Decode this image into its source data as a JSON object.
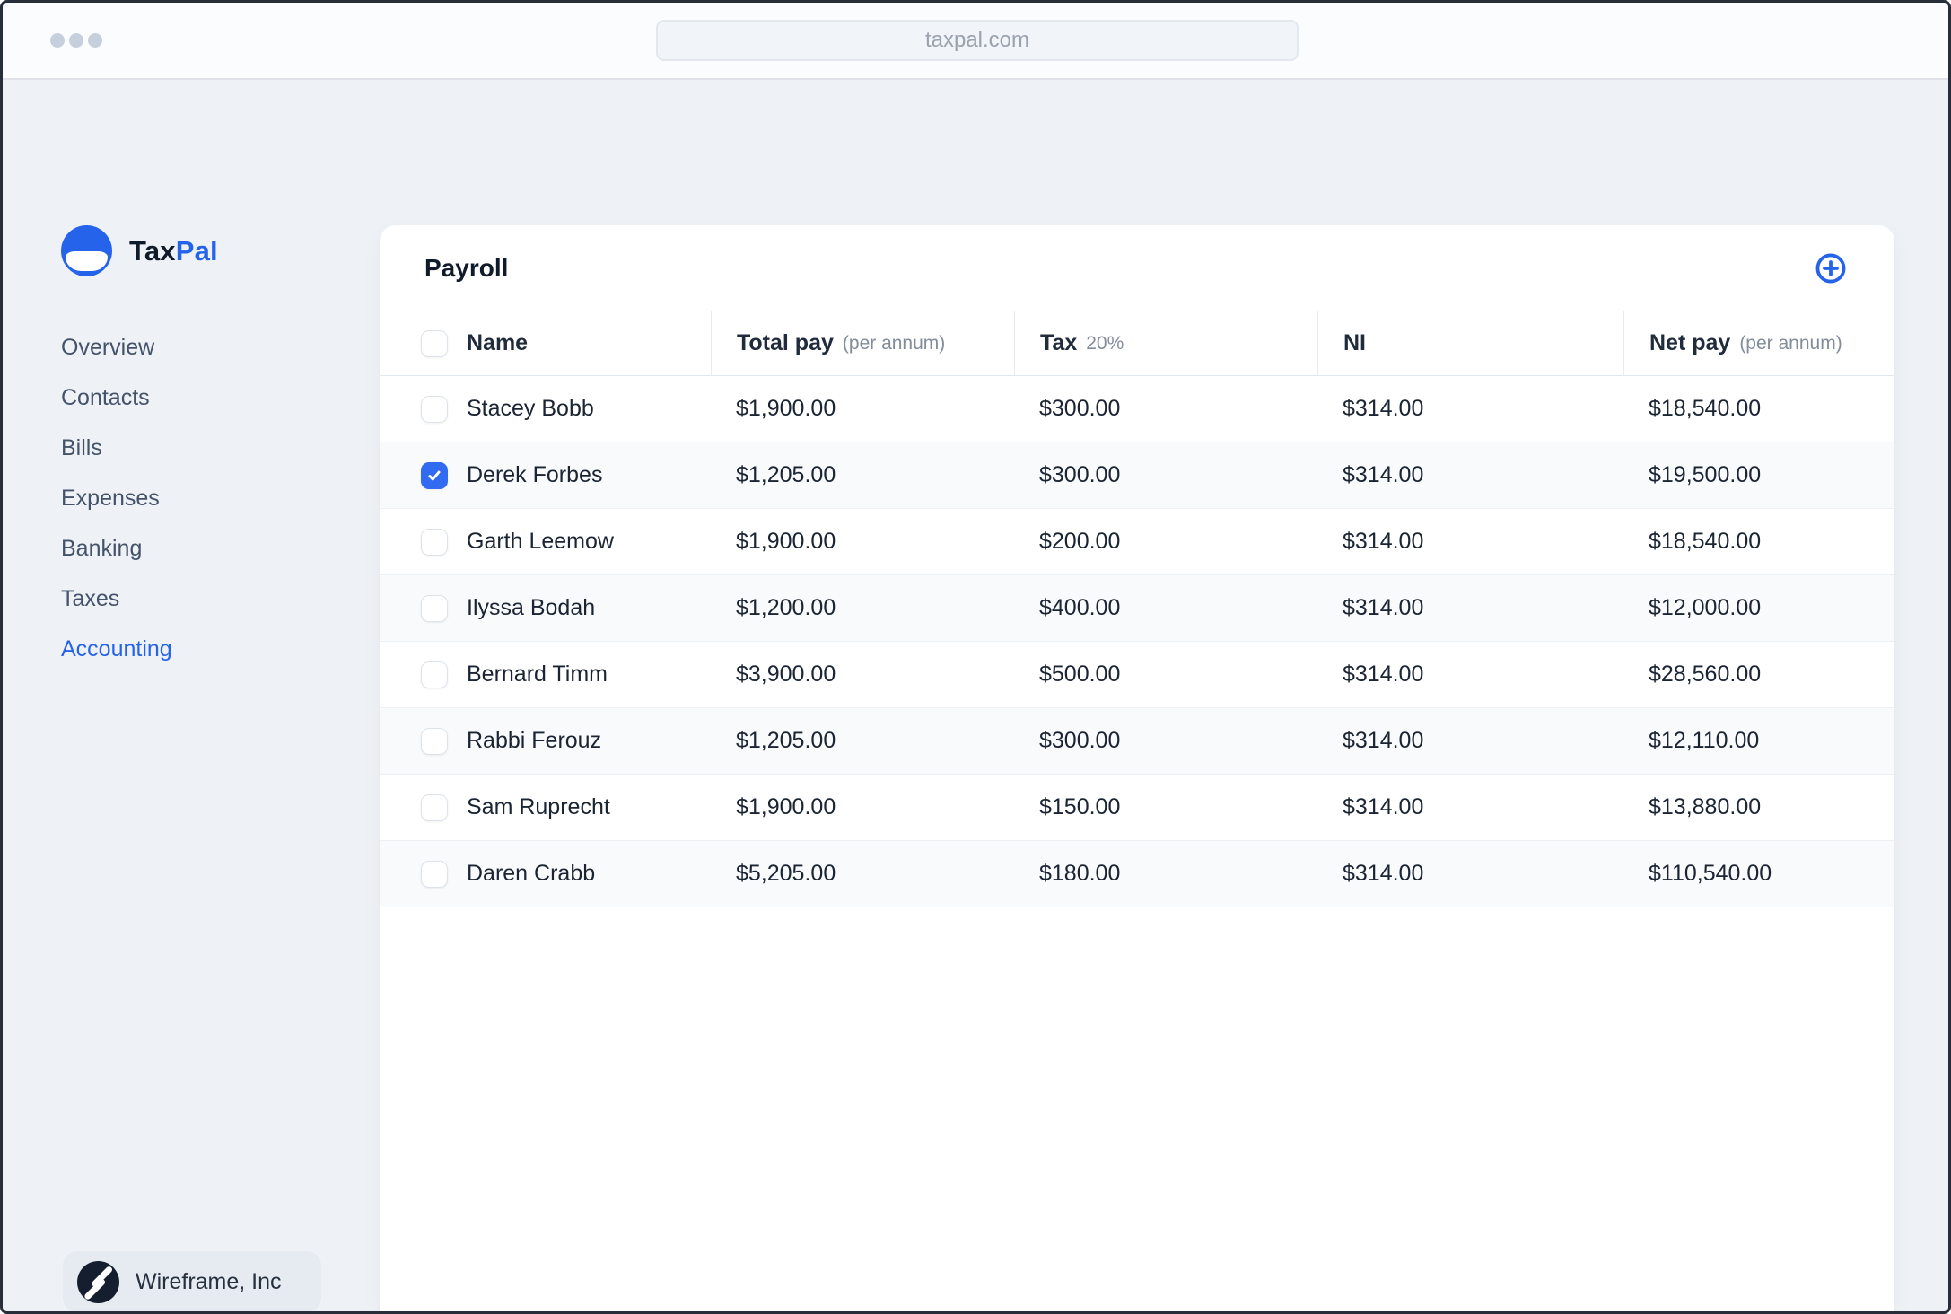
{
  "browser": {
    "url": "taxpal.com"
  },
  "sidebar": {
    "brand": {
      "primary": "Tax",
      "secondary": "Pal"
    },
    "items": [
      {
        "label": "Overview",
        "active": false
      },
      {
        "label": "Contacts",
        "active": false
      },
      {
        "label": "Bills",
        "active": false
      },
      {
        "label": "Expenses",
        "active": false
      },
      {
        "label": "Banking",
        "active": false
      },
      {
        "label": "Taxes",
        "active": false
      },
      {
        "label": "Accounting",
        "active": true
      }
    ],
    "footer": {
      "company": "Wireframe, Inc"
    }
  },
  "payroll": {
    "title": "Payroll",
    "columns": [
      {
        "label": "Name",
        "sub": ""
      },
      {
        "label": "Total pay",
        "sub": "(per annum)"
      },
      {
        "label": "Tax",
        "sub": "20%"
      },
      {
        "label": "NI",
        "sub": ""
      },
      {
        "label": "Net pay",
        "sub": "(per annum)"
      }
    ],
    "rows": [
      {
        "name": "Stacey Bobb",
        "total_pay": "$1,900.00",
        "tax": "$300.00",
        "ni": "$314.00",
        "net_pay": "$18,540.00",
        "checked": false
      },
      {
        "name": "Derek Forbes",
        "total_pay": "$1,205.00",
        "tax": "$300.00",
        "ni": "$314.00",
        "net_pay": "$19,500.00",
        "checked": true
      },
      {
        "name": "Garth Leemow",
        "total_pay": "$1,900.00",
        "tax": "$200.00",
        "ni": "$314.00",
        "net_pay": "$18,540.00",
        "checked": false
      },
      {
        "name": "Ilyssa Bodah",
        "total_pay": "$1,200.00",
        "tax": "$400.00",
        "ni": "$314.00",
        "net_pay": "$12,000.00",
        "checked": false
      },
      {
        "name": "Bernard Timm",
        "total_pay": "$3,900.00",
        "tax": "$500.00",
        "ni": "$314.00",
        "net_pay": "$28,560.00",
        "checked": false
      },
      {
        "name": "Rabbi Ferouz",
        "total_pay": "$1,205.00",
        "tax": "$300.00",
        "ni": "$314.00",
        "net_pay": "$12,110.00",
        "checked": false
      },
      {
        "name": "Sam Ruprecht",
        "total_pay": "$1,900.00",
        "tax": "$150.00",
        "ni": "$314.00",
        "net_pay": "$13,880.00",
        "checked": false
      },
      {
        "name": "Daren Crabb",
        "total_pay": "$5,205.00",
        "tax": "$180.00",
        "ni": "$314.00",
        "net_pay": "$110,540.00",
        "checked": false
      }
    ]
  },
  "icons": {
    "add_payroll": "plus-circle",
    "brand_mark": "blue-circle-smile",
    "company_mark": "dark-circle-double-slash",
    "checkbox_check": "checkmark"
  },
  "colors": {
    "accent": "#2563eb",
    "checkbox_checked": "#316bf2",
    "page_bg": "#eef2f6",
    "card_bg": "#ffffff",
    "row_alt_bg": "#f8fafb",
    "navy_text": "#1a2433",
    "muted_text": "#828c9b"
  }
}
